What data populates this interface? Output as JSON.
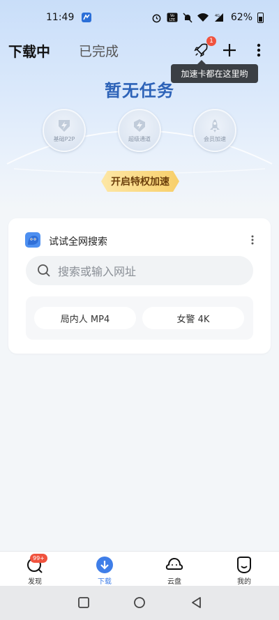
{
  "status_bar": {
    "time": "11:49",
    "battery_percent": "62%",
    "icons": [
      "app-notification-icon",
      "alarm-icon",
      "volte-icon",
      "mute-icon",
      "wifi-icon",
      "signal-4g-icon",
      "battery-icon"
    ],
    "volte_label": "VoLTE",
    "network_label": "4G"
  },
  "header": {
    "tab_downloading": "下载中",
    "tab_completed": "已完成",
    "rocket_badge": "1",
    "tooltip": "加速卡都在这里哟"
  },
  "empty_state": {
    "title": "暂无任务",
    "features": [
      {
        "label": "基础P2P",
        "icon": "p2p-lightning-icon"
      },
      {
        "label": "超级通道",
        "icon": "super-channel-icon"
      },
      {
        "label": "会员加速",
        "icon": "vip-rocket-icon"
      }
    ],
    "vip_button": "开启特权加速"
  },
  "search_card": {
    "title": "试试全网搜索",
    "search_placeholder": "搜索或输入网址",
    "suggestions": [
      "局内人 MP4",
      "女警 4K"
    ]
  },
  "bottom_nav": {
    "items": [
      {
        "label": "发现",
        "badge": "99+",
        "icon": "discover-icon"
      },
      {
        "label": "下载",
        "icon": "download-icon",
        "active": true
      },
      {
        "label": "云盘",
        "icon": "cloud-icon"
      },
      {
        "label": "我的",
        "icon": "profile-icon"
      }
    ]
  },
  "colors": {
    "accent": "#3f7ee8",
    "title_blue": "#2d63b8",
    "badge_red": "#f0533e",
    "vip_gold": "#f8cf6a"
  }
}
